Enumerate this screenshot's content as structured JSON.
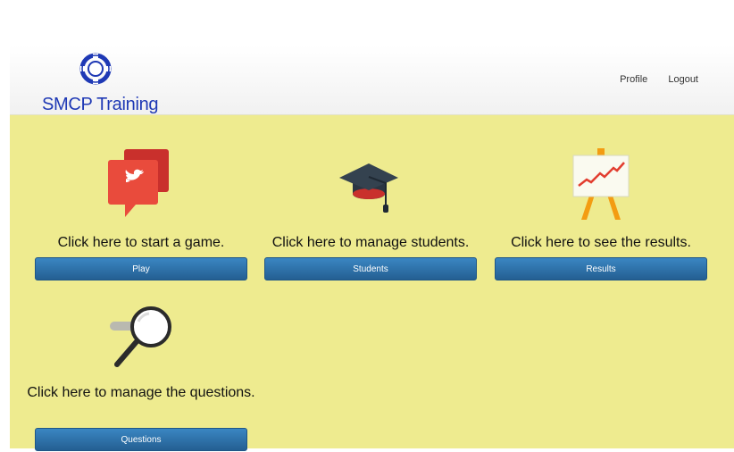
{
  "brand": {
    "name": "SMCP Training",
    "color": "#1f39b5"
  },
  "nav": {
    "profile": "Profile",
    "logout": "Logout"
  },
  "tiles": {
    "play": {
      "caption": "Click here to start a game.",
      "button": "Play",
      "icon": "speech-bubble-bird-icon"
    },
    "students": {
      "caption": "Click here to manage students.",
      "button": "Students",
      "icon": "graduation-cap-icon"
    },
    "results": {
      "caption": "Click here to see the results.",
      "button": "Results",
      "icon": "easel-chart-icon"
    },
    "questions": {
      "caption": "Click here to manage the questions.",
      "button": "Questions",
      "icon": "magnifier-icon"
    }
  },
  "colors": {
    "background": "#eeeb8f",
    "button": "#2d6fa8",
    "accent": "#e24b3c"
  }
}
